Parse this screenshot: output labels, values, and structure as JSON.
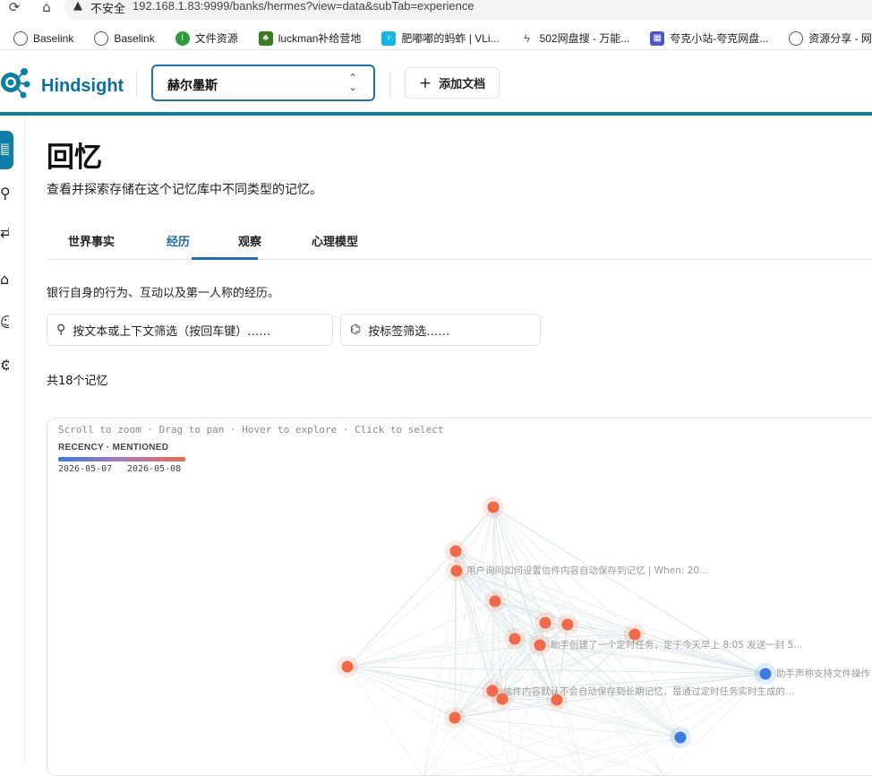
{
  "browser": {
    "insecure_label": "不安全",
    "url": "192.168.1.83:9999/banks/hermes?view=data&subTab=experience",
    "bookmarks": [
      {
        "label": "Baselink",
        "icon": "globe-icon",
        "color": "#555555"
      },
      {
        "label": "Baselink",
        "icon": "globe-icon",
        "color": "#555555"
      },
      {
        "label": "文件资源",
        "icon": "info-icon",
        "color": "#2e9b3a"
      },
      {
        "label": "luckman补给营地",
        "icon": "tree-icon",
        "color": "#3a7d1e"
      },
      {
        "label": "肥嘟嘟的蚂蚱 | VLi...",
        "icon": "vlink-icon",
        "color": "#18b4e6"
      },
      {
        "label": "502网盘搜 - 万能...",
        "icon": "lightning-icon",
        "color": "#b33"
      },
      {
        "label": "夸克小站-夸克网盘...",
        "icon": "grid-icon",
        "color": "#4a56c8"
      },
      {
        "label": "资源分享 - 网",
        "icon": "globe-icon",
        "color": "#555555"
      }
    ]
  },
  "header": {
    "brand": "Hindsight",
    "bank_name": "赫尔墨斯",
    "add_doc_label": "添加文档",
    "accent": "#0e7ea6"
  },
  "main": {
    "title": "回忆",
    "subtitle": "查看并探索存储在这个记忆库中不同类型的记忆。",
    "tabs": [
      {
        "label": "世界事实",
        "active": false
      },
      {
        "label": "经历",
        "active": true
      },
      {
        "label": "观察",
        "active": false
      },
      {
        "label": "心理模型",
        "active": false
      }
    ],
    "description": "银行自身的行为、互动以及第一人称的经历。",
    "text_filter_placeholder": "按文本或上下文筛选（按回车键）……",
    "tag_filter_placeholder": "按标签筛选……",
    "count_label": "共18个记忆"
  },
  "graph": {
    "hint": "Scroll to zoom · Drag to pan · Hover to explore · Click to select",
    "legend_title": "RECENCY · MENTIONED",
    "legend_start": "2026-05-07",
    "legend_end": "2026-05-08",
    "recent_color": "#ee6a4b",
    "old_color": "#3b7ddd",
    "node_labels": [
      "用户询问如何设置信件内容自动保存到记忆 | When: 20...",
      "助手创建了一个定时任务，定于今天早上 8:05 发送一封 5...",
      "助手声称支持文件操作",
      "信件内容默认不会自动保存到长期记忆，是通过定时任务实时生成的..."
    ]
  }
}
